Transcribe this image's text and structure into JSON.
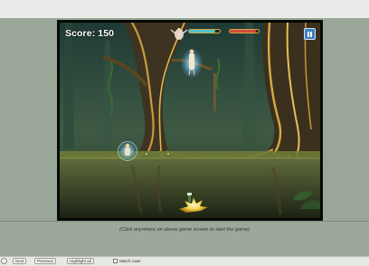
{
  "game": {
    "score_text": "Score: 150",
    "pause_icon": "pause-icon",
    "player_health": 0.85,
    "enemy_health": 0.9,
    "colors": {
      "player_bar": "#4fc1c8",
      "enemy_bar": "#d44a3a",
      "bar_frame": "#d1a94a"
    }
  },
  "hint": "(Click anywhere on above game screen to start the game)",
  "find_bar": {
    "next_label": "Next",
    "previous_label": "Previous",
    "highlight_label": "Highlight all",
    "match_case_label": "Match case"
  }
}
